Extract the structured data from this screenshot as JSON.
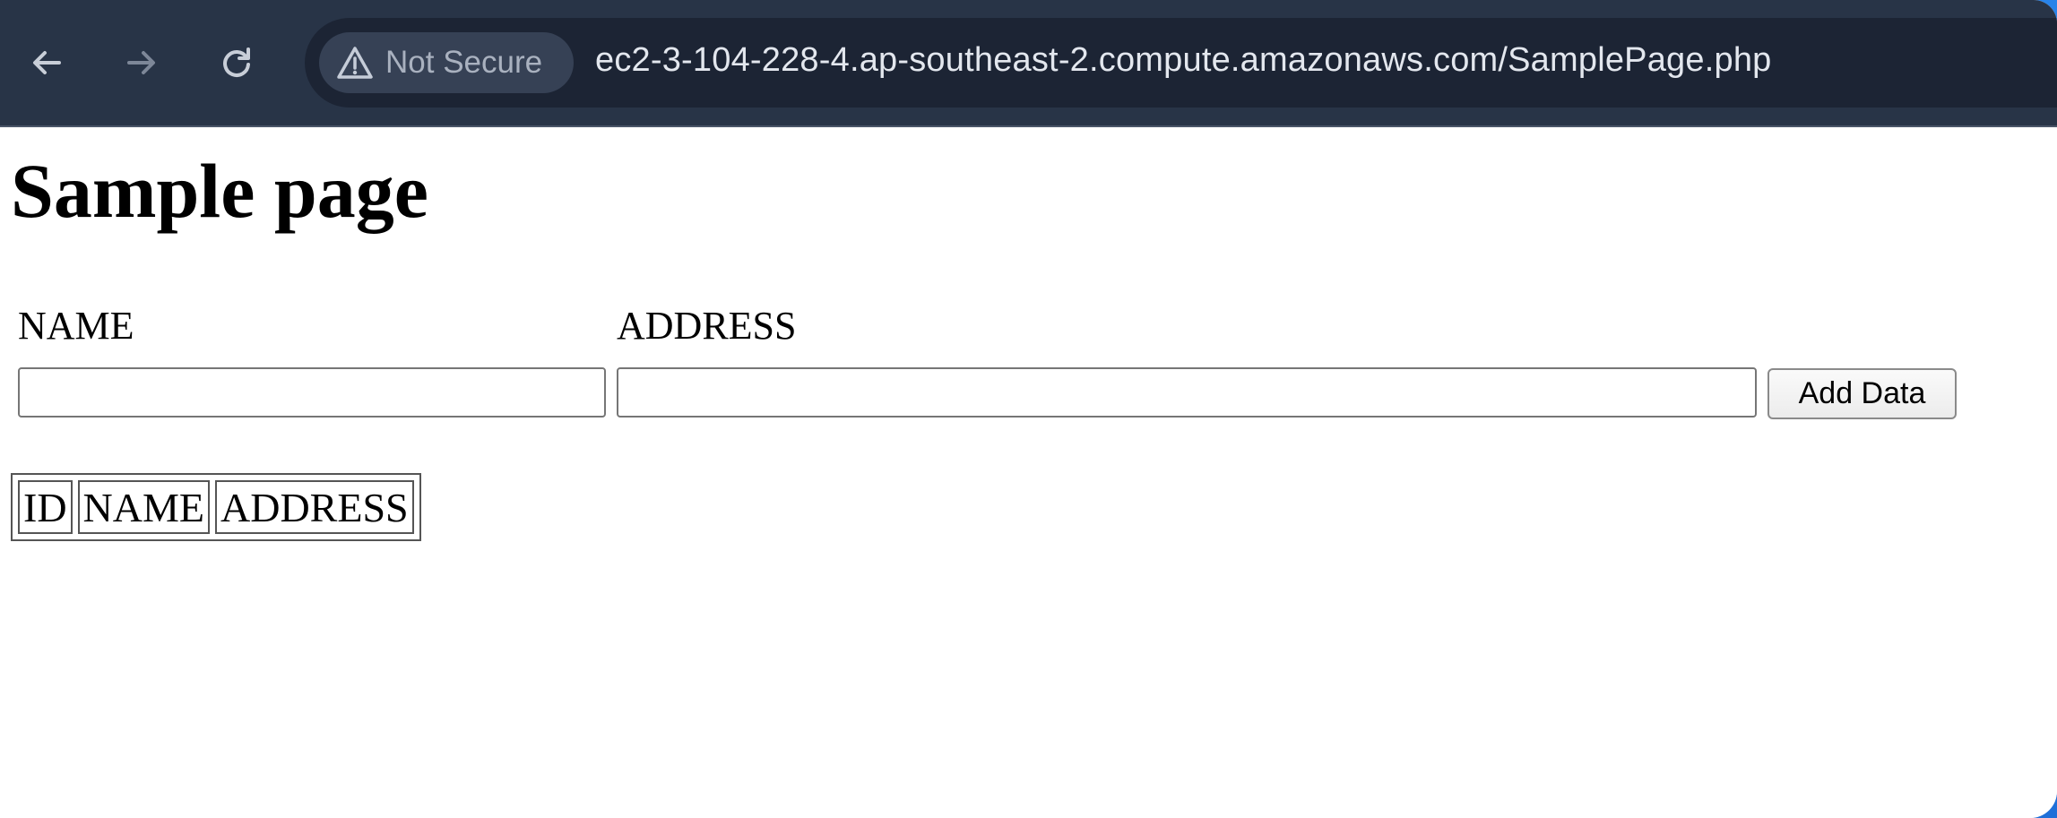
{
  "browser": {
    "security_label": "Not Secure",
    "url": "ec2-3-104-228-4.ap-southeast-2.compute.amazonaws.com/SamplePage.php",
    "icons": {
      "back": "back-arrow-icon",
      "forward": "forward-arrow-icon",
      "reload": "reload-icon",
      "security": "warning-triangle-icon"
    }
  },
  "page": {
    "title": "Sample page",
    "form": {
      "name_label": "NAME",
      "address_label": "ADDRESS",
      "name_value": "",
      "address_value": "",
      "submit_label": "Add Data"
    },
    "table": {
      "headers": [
        "ID",
        "NAME",
        "ADDRESS"
      ],
      "rows": []
    }
  },
  "colors": {
    "toolbar": "#283447",
    "omnibox": "#1c2434",
    "chip": "#364155",
    "frame": "#2a7fe0"
  }
}
